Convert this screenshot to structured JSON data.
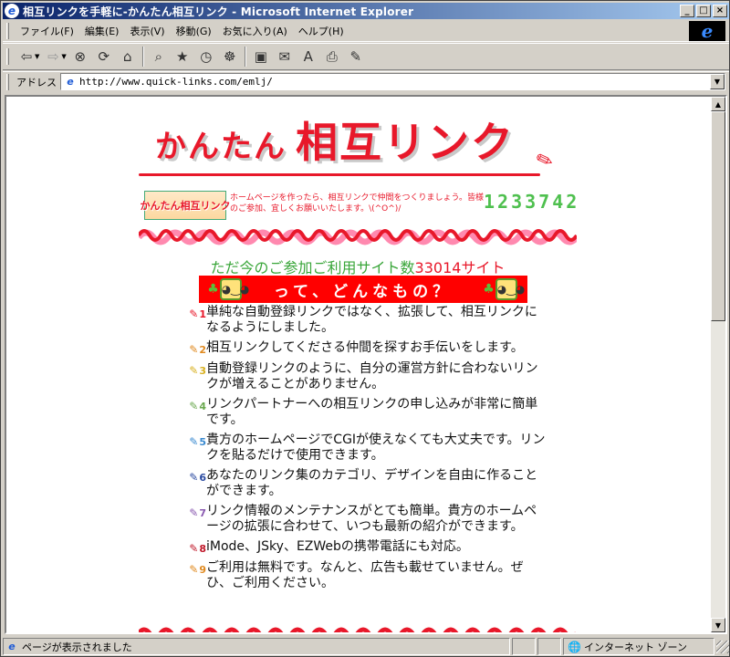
{
  "window": {
    "title": "相互リンクを手軽に-かんたん相互リンク - Microsoft Internet Explorer",
    "minimize_glyph": "_",
    "maximize_glyph": "□",
    "close_glyph": "×"
  },
  "menubar": {
    "items": [
      "ファイル(F)",
      "編集(E)",
      "表示(V)",
      "移動(G)",
      "お気に入り(A)",
      "ヘルプ(H)"
    ],
    "logo_glyph": "e"
  },
  "toolbar": {
    "back_icon": "⇦",
    "forward_icon": "⇨",
    "dropdown_glyph": "▼",
    "stop_icon": "⊗",
    "refresh_icon": "⟳",
    "home_icon": "⌂",
    "search_icon": "⌕",
    "favorites_icon": "★",
    "history_icon": "◷",
    "channels_icon": "☸",
    "fullscreen_icon": "▣",
    "mail_icon": "✉",
    "font_icon": "A",
    "print_icon": "⎙",
    "edit_icon": "✎"
  },
  "addressbar": {
    "label": "アドレス",
    "page_icon": "e",
    "url": "http://www.quick-links.com/emlj/",
    "dropdown_glyph": "▼"
  },
  "scrollbar": {
    "up_glyph": "▲",
    "down_glyph": "▼"
  },
  "page": {
    "logo_small": "かんたん",
    "logo_big": "相互リンク",
    "pen_icon": "✎",
    "banner_label": "かんたん相互リンク",
    "intro": "ホームページを作ったら、相互リンクで仲間をつくりましょう。皆様のご参加、宜しくお願いいたします。\\(^O^)/",
    "counter": "1233742",
    "heading_prefix": "ただ今のご参加ご利用サイト数",
    "heading_count": "33014サイト",
    "redbar_text": "って、どんなもの？",
    "mascot_face": "◕‿◕",
    "mascot_leaf": "♣",
    "items": [
      {
        "num": "1",
        "color": "#e8182a",
        "icon": "✎",
        "text": "単純な自動登録リンクではなく、拡張して、相互リンクになるようにしました。"
      },
      {
        "num": "2",
        "color": "#e08a20",
        "icon": "✎",
        "text": "相互リンクしてくださる仲間を探すお手伝いをします。"
      },
      {
        "num": "3",
        "color": "#d8b020",
        "icon": "✎",
        "text": "自動登録リンクのように、自分の運営方針に合わないリンクが増えることがありません。"
      },
      {
        "num": "4",
        "color": "#6aa84f",
        "icon": "✎",
        "text": "リンクパートナーへの相互リンクの申し込みが非常に簡単です。"
      },
      {
        "num": "5",
        "color": "#3a8ad0",
        "icon": "✎",
        "text": "貴方のホームページでCGIが使えなくても大丈夫です。リンクを貼るだけで使用できます。"
      },
      {
        "num": "6",
        "color": "#2a4aa0",
        "icon": "✎",
        "text": "あなたのリンク集のカテゴリ、デザインを自由に作ることができます。"
      },
      {
        "num": "7",
        "color": "#8a5ab0",
        "icon": "✎",
        "text": "リンク情報のメンテナンスがとても簡単。貴方のホームページの拡張に合わせて、いつも最新の紹介ができます。"
      },
      {
        "num": "8",
        "color": "#c0182a",
        "icon": "✎",
        "text": "iMode、JSky、EZWebの携帯電話にも対応。"
      },
      {
        "num": "9",
        "color": "#e08a20",
        "icon": "✎",
        "text": "ご利用は無料です。なんと、広告も載せていません。ぜひ、ご利用ください。"
      }
    ]
  },
  "statusbar": {
    "page_icon": "e",
    "status_text": "ページが表示されました",
    "zone_icon": "🌐",
    "zone_text": "インターネット ゾーン"
  }
}
